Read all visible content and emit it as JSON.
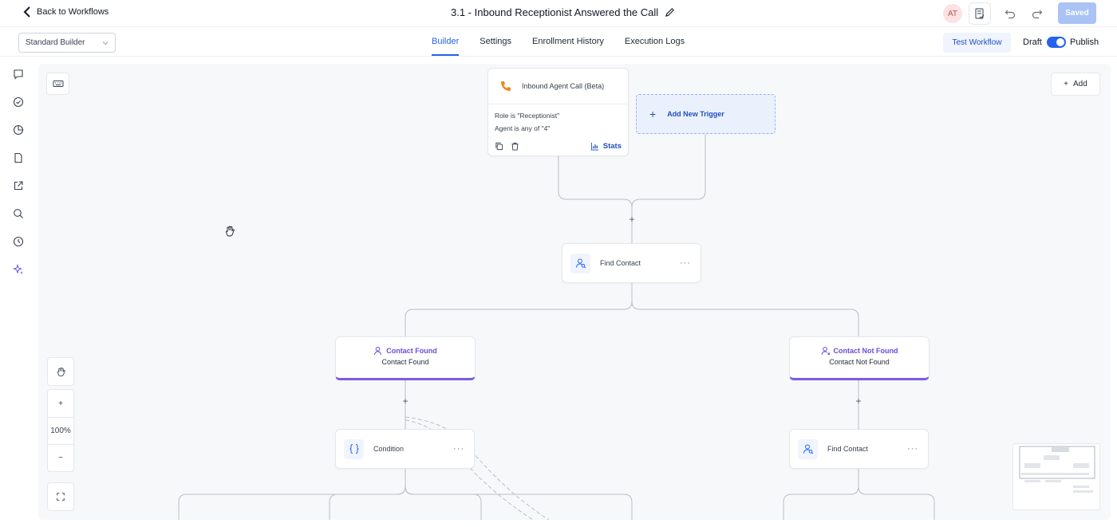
{
  "topbar": {
    "back_label": "Back to Workflows",
    "workflow_title": "3.1 - Inbound Receptionist Answered the Call",
    "avatar_initials": "AT",
    "saved_label": "Saved"
  },
  "subbar": {
    "builder_select": "Standard Builder",
    "tabs": [
      {
        "label": "Builder",
        "active": true
      },
      {
        "label": "Settings",
        "active": false
      },
      {
        "label": "Enrollment History",
        "active": false
      },
      {
        "label": "Execution Logs",
        "active": false
      }
    ],
    "test_label": "Test Workflow",
    "draft_label": "Draft",
    "publish_label": "Publish"
  },
  "canvas": {
    "add_label": "Add",
    "zoom_level": "100%",
    "trigger": {
      "title": "Inbound Agent Call (Beta)",
      "conditions": [
        "Role is \"Receptionist\"",
        "Agent is any of \"4\""
      ],
      "stats_label": "Stats"
    },
    "add_trigger_label": "Add New Trigger",
    "find_contact_label": "Find Contact",
    "branch_found": {
      "title": "Contact Found",
      "subtitle": "Contact Found"
    },
    "branch_not_found": {
      "title": "Contact Not Found",
      "subtitle": "Contact Not Found"
    },
    "condition_label": "Condition",
    "find_contact_2_label": "Find Contact"
  },
  "colors": {
    "accent": "#2563eb",
    "branch_purple": "#7c5ce0",
    "saved_bg": "#a9c3f5",
    "phone_orange": "#e8891c"
  }
}
